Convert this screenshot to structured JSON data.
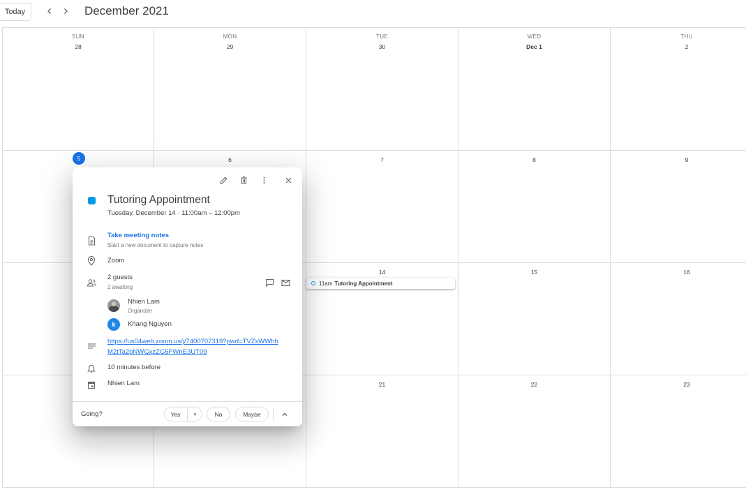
{
  "toolbar": {
    "today_label": "Today",
    "prev_icon": "chevron-left-icon",
    "next_icon": "chevron-right-icon",
    "month_title": "December 2021"
  },
  "calendar": {
    "weekdays": [
      "SUN",
      "MON",
      "TUE",
      "WED",
      "THU"
    ],
    "weeks": [
      [
        "28",
        "29",
        "30",
        "Dec 1",
        "2"
      ],
      [
        "5",
        "6",
        "7",
        "8",
        "9"
      ],
      [
        "",
        "",
        "14",
        "15",
        "16"
      ],
      [
        "",
        "",
        "21",
        "22",
        "23"
      ]
    ],
    "today": "5"
  },
  "event_chip": {
    "time": "11am",
    "title": "Tutoring Appointment",
    "color": "#039be5"
  },
  "popup": {
    "title": "Tutoring Appointment",
    "when": "Tuesday, December 14  ·  11:00am – 12:00pm",
    "color": "#039be5",
    "notes_link": "Take meeting notes",
    "notes_sub": "Start a new document to capture notes",
    "location": "Zoom",
    "guests_count": "2 guests",
    "guests_status": "2 awaiting",
    "guests": [
      {
        "name": "Nhien Lam",
        "role": "Organizer",
        "avatar": "photo"
      },
      {
        "name": "Khang Nguyen",
        "role": "",
        "avatar": "k"
      }
    ],
    "description_link": "https://us04web.zoom.us/j/7400707319?pwd=TVZsWWhhM2tTa2pNWGxzZG5FWnE3UT09",
    "reminder": "10 minutes before",
    "calendar_owner": "Nhien Lam",
    "going_label": "Going?",
    "rsvp": {
      "yes": "Yes",
      "no": "No",
      "maybe": "Maybe"
    }
  }
}
